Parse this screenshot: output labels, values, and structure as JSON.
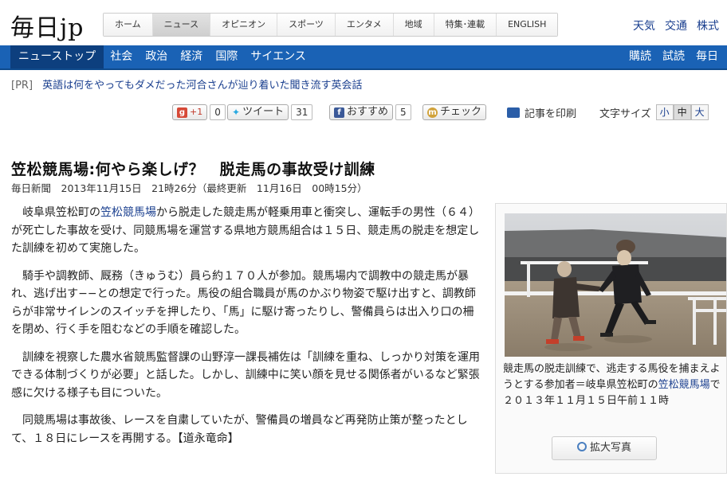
{
  "header": {
    "logo": "毎日jp",
    "nav": [
      {
        "label": "ホーム",
        "active": false
      },
      {
        "label": "ニュース",
        "active": true
      },
      {
        "label": "オピニオン",
        "active": false
      },
      {
        "label": "スポーツ",
        "active": false
      },
      {
        "label": "エンタメ",
        "active": false
      },
      {
        "label": "地域",
        "active": false
      },
      {
        "label": "特集･連載",
        "active": false
      },
      {
        "label": "ENGLISH",
        "active": false
      }
    ],
    "util_links": [
      "天気",
      "交通",
      "株式"
    ]
  },
  "subnav": {
    "items": [
      "ニューストップ",
      "社会",
      "政治",
      "経済",
      "国際",
      "サイエンス"
    ],
    "right_items": [
      "購読",
      "試読",
      "毎日"
    ]
  },
  "pr": {
    "tag": "[PR]",
    "text": "英語は何をやってもダメだった河合さんが辿り着いた聞き流す英会話"
  },
  "social": {
    "gplus_label": "+1",
    "gplus_count": "0",
    "tweet_label": "ツイート",
    "tweet_count": "31",
    "fb_label": "おすすめ",
    "fb_count": "5",
    "check_label": "チェック",
    "print_label": "記事を印刷",
    "fontsize_label": "文字サイズ",
    "fontsize_options": [
      "小",
      "中",
      "大"
    ]
  },
  "article": {
    "title": "笠松競馬場:何やら楽しげ？　脱走馬の事故受け訓練",
    "dateline": "毎日新聞　2013年11月15日　21時26分（最終更新　11月16日　00時15分）",
    "p1_a": "岐阜県笠松町の",
    "p1_link": "笠松競馬場",
    "p1_b": "から脱走した競走馬が軽乗用車と衝突し、運転手の男性（６４）が死亡した事故を受け、同競馬場を運営する県地方競馬組合は１５日、競走馬の脱走を想定した訓練を初めて実施した。",
    "p2": "騎手や調教師、厩務（きゅうむ）員ら約１７０人が参加。競馬場内で調教中の競走馬が暴れ、逃げ出す−−との想定で行った。馬役の組合職員が馬のかぶり物姿で駆け出すと、調教師らが非常サイレンのスイッチを押したり、「馬」に駆け寄ったりし、警備員らは出入り口の柵を閉め、行く手を阻むなどの手順を確認した。",
    "p3": "訓練を視察した農水省競馬監督課の山野淳一課長補佐は「訓練を重ね、しっかり対策を運用できる体制づくりが必要」と話した。しかし、訓練中に笑い顔を見せる関係者がいるなど緊張感に欠ける様子も目についた。",
    "p4": "同競馬場は事故後、レースを自粛していたが、警備員の増員など再発防止策が整ったとして、１８日にレースを再開する。【道永竜命】"
  },
  "photo": {
    "caption_a": "競走馬の脱走訓練で、逃走する馬役を捕まえようとする参加者＝岐阜県笠松町の",
    "caption_link": "笠松競馬場",
    "caption_b": "で２０１３年１１月１５日午前１１時",
    "zoom_label": "拡大写真"
  },
  "colors": {
    "subnav_bg": "#1a62b5",
    "link": "#1a3f8f"
  }
}
